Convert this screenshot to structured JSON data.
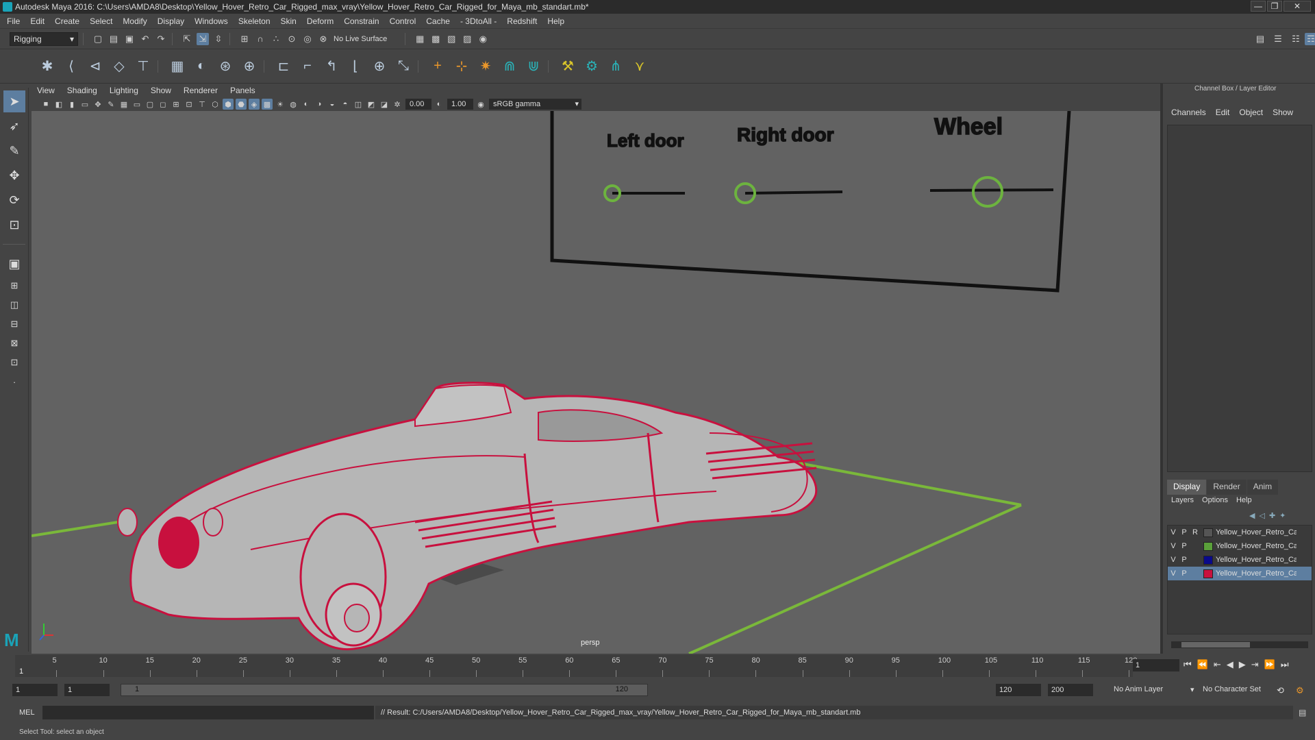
{
  "window": {
    "title": "Autodesk Maya 2016: C:\\Users\\AMDA8\\Desktop\\Yellow_Hover_Retro_Car_Rigged_max_vray\\Yellow_Hover_Retro_Car_Rigged_for_Maya_mb_standart.mb*",
    "minimize": "—",
    "maximize": "❐",
    "close": "✕"
  },
  "menubar": [
    "File",
    "Edit",
    "Create",
    "Select",
    "Modify",
    "Display",
    "Windows",
    "Skeleton",
    "Skin",
    "Deform",
    "Constrain",
    "Control",
    "Cache",
    "- 3DtoAll -",
    "Redshift",
    "Help"
  ],
  "statusline": {
    "mode": "Rigging",
    "live_surface": "No Live Surface"
  },
  "viewport": {
    "menu": [
      "View",
      "Shading",
      "Lighting",
      "Show",
      "Renderer",
      "Panels"
    ],
    "exposure": "0.00",
    "gamma": "1.00",
    "color_space": "sRGB gamma",
    "camera_label": "persp",
    "control_board": {
      "labels": [
        "Left door",
        "Right door",
        "Wheel"
      ],
      "control_color": "#6db33f"
    },
    "wire_color": "#c8103e",
    "grid_color": "#7ab83a"
  },
  "channelbox": {
    "title": "Channel Box / Layer Editor",
    "menu": [
      "Channels",
      "Edit",
      "Object",
      "Show"
    ],
    "layer_tabs": [
      "Display",
      "Render",
      "Anim"
    ],
    "layer_menu": [
      "Layers",
      "Options",
      "Help"
    ],
    "layers": [
      {
        "v": "V",
        "p": "P",
        "r": "R",
        "color": "#555555",
        "name": "Yellow_Hover_Retro_Car"
      },
      {
        "v": "V",
        "p": "P",
        "r": "",
        "color": "#5aa03a",
        "name": "Yellow_Hover_Retro_Car"
      },
      {
        "v": "V",
        "p": "P",
        "r": "",
        "color": "#0a0a8a",
        "name": "Yellow_Hover_Retro_Car"
      },
      {
        "v": "V",
        "p": "P",
        "r": "",
        "color": "#c8103e",
        "name": "Yellow_Hover_Retro_Car"
      }
    ]
  },
  "timeline": {
    "ticks": [
      "5",
      "10",
      "15",
      "20",
      "25",
      "30",
      "35",
      "40",
      "45",
      "50",
      "55",
      "60",
      "65",
      "70",
      "75",
      "80",
      "85",
      "90",
      "95",
      "100",
      "105",
      "110",
      "115",
      "120"
    ],
    "current_frame_marker": "1",
    "current_frame": "1",
    "start": 1,
    "end": 120
  },
  "range": {
    "start_time": "1",
    "playback_start": "1",
    "slider_start": "1",
    "slider_end": "120",
    "playback_end": "120",
    "end_time": "200",
    "anim_layer": "No Anim Layer",
    "character_set": "No Character Set"
  },
  "command": {
    "mode": "MEL",
    "result": "// Result: C:/Users/AMDA8/Desktop/Yellow_Hover_Retro_Car_Rigged_max_vray/Yellow_Hover_Retro_Car_Rigged_for_Maya_mb_standart.mb"
  },
  "helpline": "Select Tool: select an object"
}
